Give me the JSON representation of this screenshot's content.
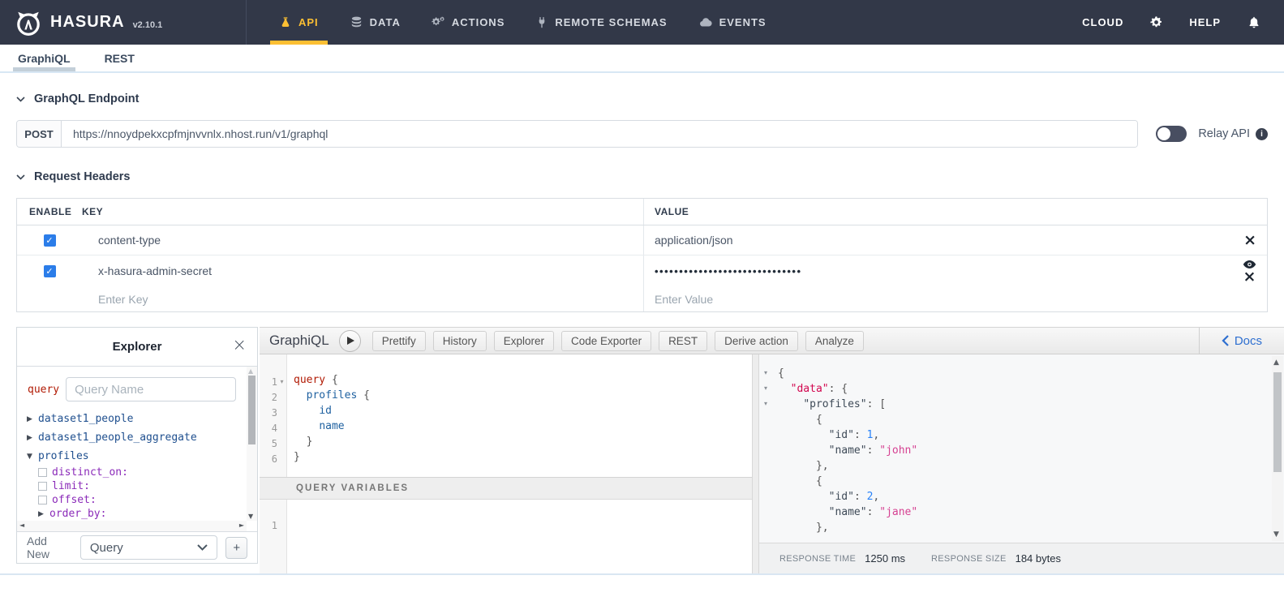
{
  "colors": {
    "topbar_bg": "#323848",
    "accent_yellow": "#fcbf33",
    "checkbox_blue": "#2b7de9",
    "docs_blue": "#2e6fd0",
    "keyword_red": "#B11A04",
    "field_blue": "#1F61A0",
    "def_pink": "#D2054E",
    "number_blue": "#2882F9",
    "string_pink": "#D64292"
  },
  "topbar": {
    "brand": "HASURA",
    "version": "v2.10.1",
    "nav": [
      {
        "icon": "flask-icon",
        "label": "API",
        "active": true
      },
      {
        "icon": "database-icon",
        "label": "DATA",
        "active": false
      },
      {
        "icon": "gears-icon",
        "label": "ACTIONS",
        "active": false
      },
      {
        "icon": "plug-icon",
        "label": "REMOTE SCHEMAS",
        "active": false
      },
      {
        "icon": "cloud-icon",
        "label": "EVENTS",
        "active": false
      }
    ],
    "cloud_label": "CLOUD",
    "help_label": "HELP"
  },
  "subtabs": [
    {
      "label": "GraphiQL",
      "active": true
    },
    {
      "label": "REST",
      "active": false
    }
  ],
  "endpoint": {
    "section_title": "GraphQL Endpoint",
    "method": "POST",
    "url": "https://nnoydpekxcpfmjnvvnlx.nhost.run/v1/graphql",
    "relay_label": "Relay API",
    "relay_enabled": false
  },
  "request_headers": {
    "section_title": "Request Headers",
    "columns": {
      "enable": "ENABLE",
      "key": "KEY",
      "value": "VALUE"
    },
    "rows": [
      {
        "enabled": true,
        "key": "content-type",
        "value": "application/json",
        "masked": false,
        "actions": [
          "remove"
        ]
      },
      {
        "enabled": true,
        "key": "x-hasura-admin-secret",
        "value": "••••••••••••••••••••••••••••••",
        "masked": true,
        "actions": [
          "reveal",
          "remove"
        ]
      }
    ],
    "key_placeholder": "Enter Key",
    "value_placeholder": "Enter Value"
  },
  "explorer": {
    "title": "Explorer",
    "operation_label": "query",
    "name_placeholder": "Query Name",
    "tree": [
      {
        "label": "dataset1_people",
        "arrow": "collapsed",
        "kind": "field",
        "indent": 0
      },
      {
        "label": "dataset1_people_aggregate",
        "arrow": "collapsed",
        "kind": "field",
        "indent": 0
      },
      {
        "label": "profiles",
        "arrow": "expanded",
        "kind": "field",
        "indent": 0
      },
      {
        "label": "distinct_on:",
        "checkbox": true,
        "kind": "arg",
        "indent": 1
      },
      {
        "label": "limit:",
        "checkbox": true,
        "kind": "arg",
        "indent": 1
      },
      {
        "label": "offset:",
        "checkbox": true,
        "kind": "arg",
        "indent": 1
      },
      {
        "label": "order_by:",
        "arrow": "collapsed",
        "kind": "arg",
        "indent": 1
      }
    ],
    "add_new_label": "Add New",
    "add_new_selected": "Query",
    "add_button_label": "+"
  },
  "graphiql": {
    "title": "GraphiQL",
    "toolbar_buttons": [
      "Prettify",
      "History",
      "Explorer",
      "Code Exporter",
      "REST",
      "Derive action",
      "Analyze"
    ],
    "docs_label": "Docs",
    "query_lines": [
      {
        "num": "1",
        "fold": true,
        "tokens": [
          [
            "kw",
            "query "
          ],
          [
            "pun",
            "{"
          ]
        ]
      },
      {
        "num": "2",
        "fold": false,
        "tokens": [
          [
            "pln",
            "  "
          ],
          [
            "prop",
            "profiles "
          ],
          [
            "pun",
            "{"
          ]
        ]
      },
      {
        "num": "3",
        "fold": false,
        "tokens": [
          [
            "pln",
            "    "
          ],
          [
            "prop",
            "id"
          ]
        ]
      },
      {
        "num": "4",
        "fold": false,
        "tokens": [
          [
            "pln",
            "    "
          ],
          [
            "prop",
            "name"
          ]
        ]
      },
      {
        "num": "5",
        "fold": false,
        "tokens": [
          [
            "pun",
            "  }"
          ]
        ]
      },
      {
        "num": "6",
        "fold": false,
        "tokens": [
          [
            "pun",
            "}"
          ]
        ]
      }
    ],
    "variables_title": "QUERY VARIABLES",
    "variables_line_number": "1",
    "response_lines": [
      {
        "fold": true,
        "tokens": [
          [
            "pun",
            "{"
          ]
        ]
      },
      {
        "fold": true,
        "tokens": [
          [
            "pln",
            "  "
          ],
          [
            "def",
            "\"data\""
          ],
          [
            "pun",
            ": {"
          ]
        ]
      },
      {
        "fold": true,
        "tokens": [
          [
            "pln",
            "    "
          ],
          [
            "key",
            "\"profiles\""
          ],
          [
            "pun",
            ": ["
          ]
        ]
      },
      {
        "fold": false,
        "tokens": [
          [
            "pun",
            "      {"
          ]
        ]
      },
      {
        "fold": false,
        "tokens": [
          [
            "pln",
            "        "
          ],
          [
            "key",
            "\"id\""
          ],
          [
            "pun",
            ": "
          ],
          [
            "num",
            "1"
          ],
          [
            "pun",
            ","
          ]
        ]
      },
      {
        "fold": false,
        "tokens": [
          [
            "pln",
            "        "
          ],
          [
            "key",
            "\"name\""
          ],
          [
            "pun",
            ": "
          ],
          [
            "str",
            "\"john\""
          ]
        ]
      },
      {
        "fold": false,
        "tokens": [
          [
            "pun",
            "      },"
          ]
        ]
      },
      {
        "fold": false,
        "tokens": [
          [
            "pun",
            "      {"
          ]
        ]
      },
      {
        "fold": false,
        "tokens": [
          [
            "pln",
            "        "
          ],
          [
            "key",
            "\"id\""
          ],
          [
            "pun",
            ": "
          ],
          [
            "num",
            "2"
          ],
          [
            "pun",
            ","
          ]
        ]
      },
      {
        "fold": false,
        "tokens": [
          [
            "pln",
            "        "
          ],
          [
            "key",
            "\"name\""
          ],
          [
            "pun",
            ": "
          ],
          [
            "str",
            "\"jane\""
          ]
        ]
      },
      {
        "fold": false,
        "tokens": [
          [
            "pun",
            "      },"
          ]
        ]
      }
    ],
    "footer": {
      "time_label": "RESPONSE TIME",
      "time_value": "1250 ms",
      "size_label": "RESPONSE SIZE",
      "size_value": "184 bytes"
    }
  }
}
